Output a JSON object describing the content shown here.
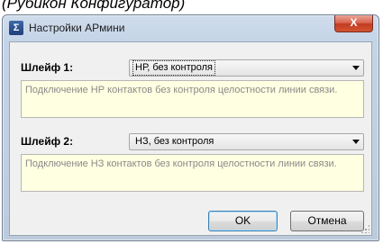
{
  "caption": "(Рубикон Конфигуратор)",
  "window": {
    "title": "Настройки АРмини",
    "app_icon_glyph": "Σ",
    "close_glyph": "X"
  },
  "loop1": {
    "label": "Шлейф 1:",
    "selected": "НР, без контроля",
    "description": "Подключение НР контактов без контроля целостности линии связи."
  },
  "loop2": {
    "label": "Шлейф 2:",
    "selected": "НЗ, без контроля",
    "description": "Подключение НЗ контактов без контроля целостности линии связи."
  },
  "buttons": {
    "ok": "OK",
    "cancel": "Отмена"
  },
  "colors": {
    "hint_bg": "#ffffe1",
    "close_red": "#c23b22",
    "default_button_border": "#3c7fb1"
  }
}
